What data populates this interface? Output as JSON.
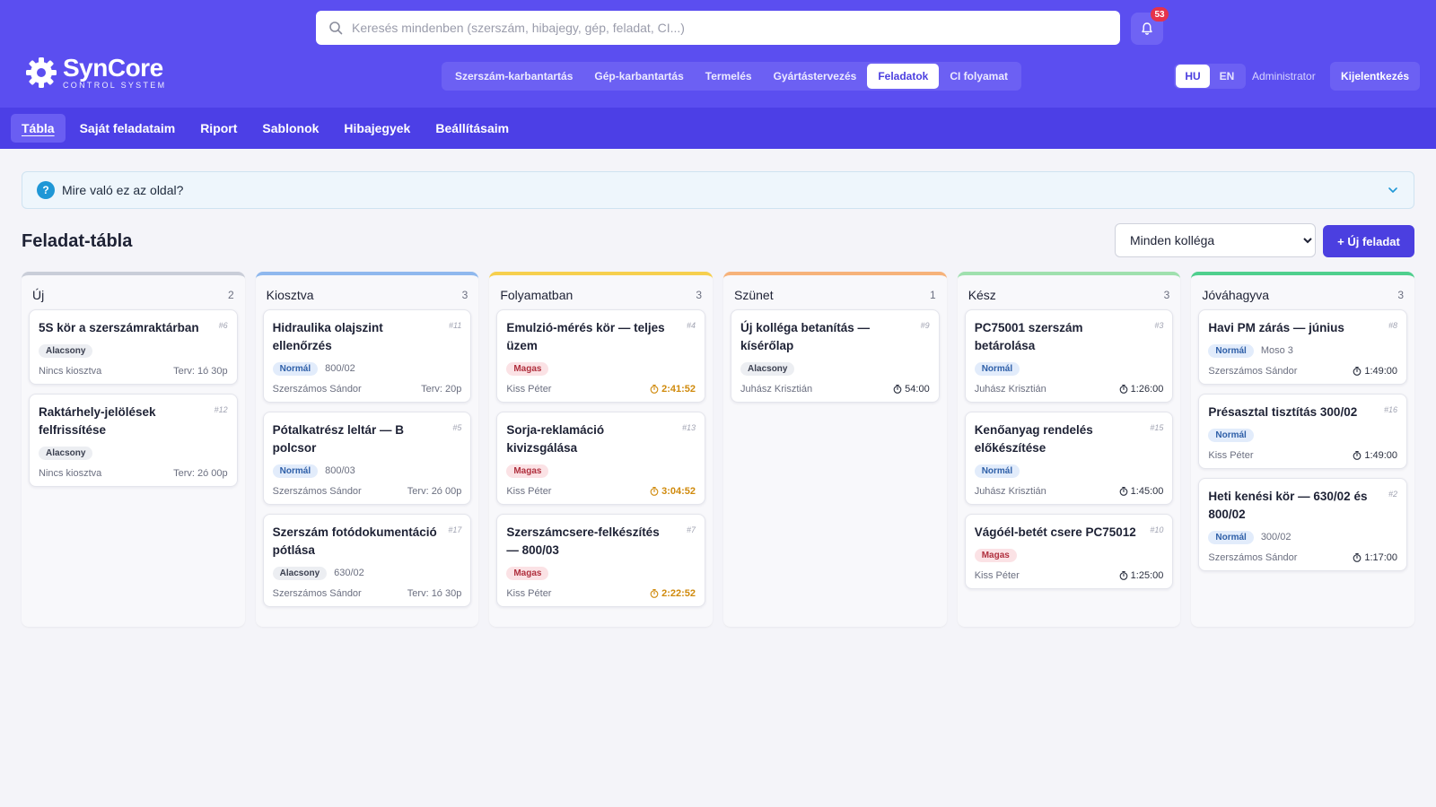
{
  "search": {
    "placeholder": "Keresés mindenben (szerszám, hibajegy, gép, feladat, CI...)"
  },
  "notifications": {
    "count": "53"
  },
  "logo": {
    "name": "SynCore",
    "subtitle": "CONTROL SYSTEM"
  },
  "modules": [
    {
      "label": "Szerszám-karbantartás",
      "active": false
    },
    {
      "label": "Gép-karbantartás",
      "active": false
    },
    {
      "label": "Termelés",
      "active": false
    },
    {
      "label": "Gyártástervezés",
      "active": false
    },
    {
      "label": "Feladatok",
      "active": true
    },
    {
      "label": "CI folyamat",
      "active": false
    }
  ],
  "language": {
    "hu": "HU",
    "en": "EN",
    "active": "HU"
  },
  "user": {
    "name": "Administrator",
    "logout_label": "Kijelentkezés"
  },
  "subnav": [
    {
      "label": "Tábla",
      "active": true
    },
    {
      "label": "Saját feladataim",
      "active": false
    },
    {
      "label": "Riport",
      "active": false
    },
    {
      "label": "Sablonok",
      "active": false
    },
    {
      "label": "Hibajegyek",
      "active": false
    },
    {
      "label": "Beállításaim",
      "active": false
    }
  ],
  "help": {
    "icon": "?",
    "title": "Mire való ez az oldal?"
  },
  "board": {
    "title": "Feladat-tábla",
    "filter": {
      "selected": "Minden kolléga",
      "options": [
        "Minden kolléga"
      ]
    },
    "new_task_label": "+ Új feladat",
    "columns": [
      {
        "title": "Új",
        "count": "2",
        "color": "#c9cdd8",
        "cards": [
          {
            "id": "#6",
            "title": "5S kör a szerszámraktárban",
            "priority": "Alacsony",
            "level": "low",
            "machine": "",
            "assignee": "Nincs kiosztva",
            "time": "Terv: 1ó 30p",
            "timer": false,
            "warn": false
          },
          {
            "id": "#12",
            "title": "Raktárhely-jelölések felfrissítése",
            "priority": "Alacsony",
            "level": "low",
            "machine": "",
            "assignee": "Nincs kiosztva",
            "time": "Terv: 2ó 00p",
            "timer": false,
            "warn": false
          }
        ]
      },
      {
        "title": "Kiosztva",
        "count": "3",
        "color": "#8fb8ee",
        "cards": [
          {
            "id": "#11",
            "title": "Hidraulika olajszint ellenőrzés",
            "priority": "Normál",
            "level": "normal",
            "machine": "800/02",
            "assignee": "Szerszámos Sándor",
            "time": "Terv: 20p",
            "timer": false,
            "warn": false
          },
          {
            "id": "#5",
            "title": "Pótalkatrész leltár — B polcsor",
            "priority": "Normál",
            "level": "normal",
            "machine": "800/03",
            "assignee": "Szerszámos Sándor",
            "time": "Terv: 2ó 00p",
            "timer": false,
            "warn": false
          },
          {
            "id": "#17",
            "title": "Szerszám fotódokumentáció pótlása",
            "priority": "Alacsony",
            "level": "low",
            "machine": "630/02",
            "assignee": "Szerszámos Sándor",
            "time": "Terv: 1ó 30p",
            "timer": false,
            "warn": false
          }
        ]
      },
      {
        "title": "Folyamatban",
        "count": "3",
        "color": "#f6cf4e",
        "cards": [
          {
            "id": "#4",
            "title": "Emulzió-mérés kör — teljes üzem",
            "priority": "Magas",
            "level": "high",
            "machine": "",
            "assignee": "Kiss Péter",
            "time": "2:41:52",
            "timer": true,
            "warn": true
          },
          {
            "id": "#13",
            "title": "Sorja-reklamáció kivizsgálása",
            "priority": "Magas",
            "level": "high",
            "machine": "",
            "assignee": "Kiss Péter",
            "time": "3:04:52",
            "timer": true,
            "warn": true
          },
          {
            "id": "#7",
            "title": "Szerszámcsere-felkészítés — 800/03",
            "priority": "Magas",
            "level": "high",
            "machine": "",
            "assignee": "Kiss Péter",
            "time": "2:22:52",
            "timer": true,
            "warn": true
          }
        ]
      },
      {
        "title": "Szünet",
        "count": "1",
        "color": "#f6b27a",
        "cards": [
          {
            "id": "#9",
            "title": "Új kolléga betanítás — kísérőlap",
            "priority": "Alacsony",
            "level": "low",
            "machine": "",
            "assignee": "Juhász Krisztián",
            "time": "54:00",
            "timer": true,
            "warn": false
          }
        ]
      },
      {
        "title": "Kész",
        "count": "3",
        "color": "#9fe0ae",
        "cards": [
          {
            "id": "#3",
            "title": "PC75001 szerszám betárolása",
            "priority": "Normál",
            "level": "normal",
            "machine": "",
            "assignee": "Juhász Krisztián",
            "time": "1:26:00",
            "timer": true,
            "warn": false
          },
          {
            "id": "#15",
            "title": "Kenőanyag rendelés előkészítése",
            "priority": "Normál",
            "level": "normal",
            "machine": "",
            "assignee": "Juhász Krisztián",
            "time": "1:45:00",
            "timer": true,
            "warn": false
          },
          {
            "id": "#10",
            "title": "Vágóél-betét csere PC75012",
            "priority": "Magas",
            "level": "high",
            "machine": "",
            "assignee": "Kiss Péter",
            "time": "1:25:00",
            "timer": true,
            "warn": false
          }
        ]
      },
      {
        "title": "Jóváhagyva",
        "count": "3",
        "color": "#4fcf8e",
        "cards": [
          {
            "id": "#8",
            "title": "Havi PM zárás — június",
            "priority": "Normál",
            "level": "normal",
            "machine": "Moso 3",
            "assignee": "Szerszámos Sándor",
            "time": "1:49:00",
            "timer": true,
            "warn": false
          },
          {
            "id": "#16",
            "title": "Présasztal tisztítás 300/02",
            "priority": "Normál",
            "level": "normal",
            "machine": "",
            "assignee": "Kiss Péter",
            "time": "1:49:00",
            "timer": true,
            "warn": false
          },
          {
            "id": "#2",
            "title": "Heti kenési kör — 630/02 és 800/02",
            "priority": "Normál",
            "level": "normal",
            "machine": "300/02",
            "assignee": "Szerszámos Sándor",
            "time": "1:17:00",
            "timer": true,
            "warn": false
          }
        ]
      }
    ]
  }
}
